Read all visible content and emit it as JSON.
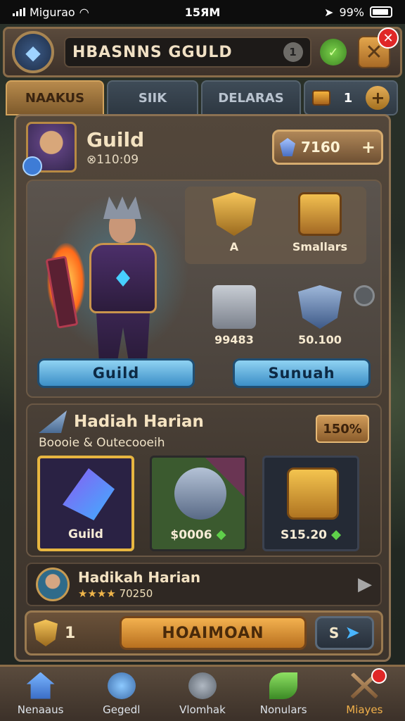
{
  "status_bar": {
    "carrier": "Migurao",
    "time": "15ЯM",
    "battery": "99%"
  },
  "header": {
    "title": "HBASNNS GGULD",
    "info_label": "1",
    "close_label": "✕"
  },
  "tabs": [
    {
      "label": "NAAKUS",
      "active": true
    },
    {
      "label": "SIIK",
      "active": false
    },
    {
      "label": "DELARAS",
      "active": false
    }
  ],
  "tab_resource": {
    "value": "1"
  },
  "guild": {
    "name": "Guild",
    "sub": "⊗110:09",
    "gems": "7160"
  },
  "items": [
    {
      "label": "A",
      "icon": "gold-shield-icon"
    },
    {
      "label": "Smallars",
      "icon": "gold-chest-icon"
    },
    {
      "label": "99483",
      "icon": "armor-icon"
    },
    {
      "label": "50.100",
      "icon": "blue-shield-icon"
    }
  ],
  "buttons": {
    "guild": "Guild",
    "sunuah": "Sunuah"
  },
  "rewards": {
    "title": "Hadiah Harian",
    "subtitle": "Boooie & Outecooeih",
    "percent": "150%",
    "cards": [
      {
        "label": "Guild",
        "icon": "crystal-dagger-icon"
      },
      {
        "label": "$0006",
        "icon": "silver-gauntlet-icon"
      },
      {
        "label": "S15.20",
        "icon": "golden-chest-icon"
      }
    ]
  },
  "notice": {
    "title": "Hadikah Harian",
    "stars": "★★★★",
    "detail": "70250"
  },
  "action_bar": {
    "count": "1",
    "main_label": "HOAIMOAN",
    "share_label": "S"
  },
  "nav": [
    {
      "label": "Nenaaus",
      "icon": "home-icon",
      "active": false
    },
    {
      "label": "Gegedl",
      "icon": "gear-icon",
      "active": false
    },
    {
      "label": "Vlomhak",
      "icon": "search-icon",
      "active": false
    },
    {
      "label": "Nonulars",
      "icon": "leaf-icon",
      "active": false
    },
    {
      "label": "Miayes",
      "icon": "swords-icon",
      "active": true
    }
  ]
}
